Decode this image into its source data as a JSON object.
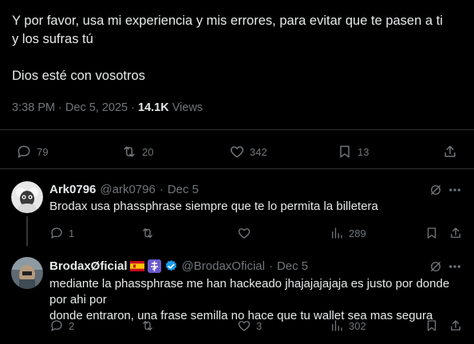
{
  "tweet": {
    "text_line1": "Y por favor, usa mi experiencia y mis errores, para evitar que te pasen a ti",
    "text_line2": "y los sufras tú",
    "text_line3": "Dios esté con vosotros",
    "time": "3:38 PM",
    "date": "Dec 5, 2025",
    "views_count": "14.1K",
    "views_label": "Views",
    "stats": {
      "replies": "79",
      "retweets": "20",
      "likes": "342",
      "bookmarks": "13"
    }
  },
  "replies": [
    {
      "display_name": "Ark0796",
      "handle": "@ark0796",
      "date": "Dec 5",
      "text": "Brodax usa phassphrase siempre que te lo permita la billetera",
      "replies": "1",
      "retweets": "",
      "likes": "",
      "views": "289"
    },
    {
      "display_name": "BrodaxØficial",
      "handle": "@BrodaxOficial",
      "date": "Dec 5",
      "text_line1": "mediante la phassphrase me han hackeado jhajajajajaja es justo por donde por ahi por",
      "text_line2": "donde entraron, una frase semilla no hace que tu wallet sea mas segura",
      "replies": "2",
      "retweets": "",
      "likes": "3",
      "views": "302"
    }
  ],
  "icons": {
    "reply": "reply-icon",
    "retweet": "retweet-icon",
    "like": "heart-icon",
    "bookmark": "bookmark-icon",
    "share": "share-icon",
    "views": "views-icon",
    "grok": "grok-icon",
    "more": "more-icon"
  },
  "separator": "·"
}
